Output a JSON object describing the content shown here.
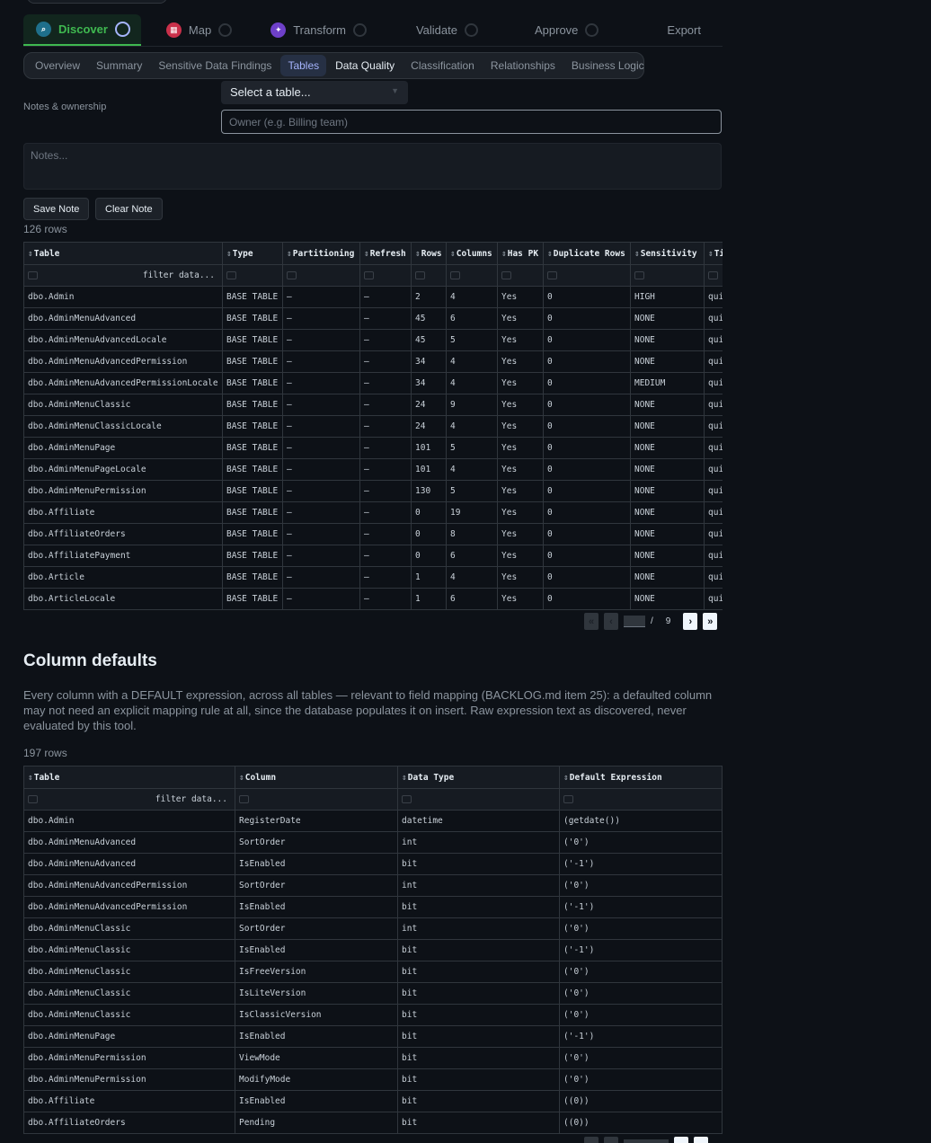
{
  "steps": [
    {
      "label": "Discover",
      "active": true
    },
    {
      "label": "Map"
    },
    {
      "label": "Transform"
    },
    {
      "label": "Validate"
    },
    {
      "label": "Approve"
    },
    {
      "label": "Export"
    }
  ],
  "subtabs": [
    "Overview",
    "Summary",
    "Sensitive Data Findings",
    "Tables",
    "Data Quality",
    "Classification",
    "Relationships",
    "Business Logic"
  ],
  "selected_subtab": "Tables",
  "table_select": {
    "value": "Select a table..."
  },
  "notes": {
    "label": "Notes & ownership",
    "owner_placeholder": "Owner (e.g. Billing team)",
    "notes_placeholder": "Notes...",
    "save_label": "Save Note",
    "clear_label": "Clear Note"
  },
  "tables_grid": {
    "row_count": "126 rows",
    "filter_placeholder": "filter data...",
    "columns": [
      "Table",
      "Type",
      "Partitioning",
      "Refresh",
      "Rows",
      "Columns",
      "Has PK",
      "Duplicate Rows",
      "Sensitivity",
      "Ti"
    ],
    "rows": [
      [
        "dbo.Admin",
        "BASE TABLE",
        "—",
        "—",
        "2",
        "4",
        "Yes",
        "0",
        "HIGH",
        "qui"
      ],
      [
        "dbo.AdminMenuAdvanced",
        "BASE TABLE",
        "—",
        "—",
        "45",
        "6",
        "Yes",
        "0",
        "NONE",
        "qui"
      ],
      [
        "dbo.AdminMenuAdvancedLocale",
        "BASE TABLE",
        "—",
        "—",
        "45",
        "5",
        "Yes",
        "0",
        "NONE",
        "qui"
      ],
      [
        "dbo.AdminMenuAdvancedPermission",
        "BASE TABLE",
        "—",
        "—",
        "34",
        "4",
        "Yes",
        "0",
        "NONE",
        "qui"
      ],
      [
        "dbo.AdminMenuAdvancedPermissionLocale",
        "BASE TABLE",
        "—",
        "—",
        "34",
        "4",
        "Yes",
        "0",
        "MEDIUM",
        "qui"
      ],
      [
        "dbo.AdminMenuClassic",
        "BASE TABLE",
        "—",
        "—",
        "24",
        "9",
        "Yes",
        "0",
        "NONE",
        "qui"
      ],
      [
        "dbo.AdminMenuClassicLocale",
        "BASE TABLE",
        "—",
        "—",
        "24",
        "4",
        "Yes",
        "0",
        "NONE",
        "qui"
      ],
      [
        "dbo.AdminMenuPage",
        "BASE TABLE",
        "—",
        "—",
        "101",
        "5",
        "Yes",
        "0",
        "NONE",
        "qui"
      ],
      [
        "dbo.AdminMenuPageLocale",
        "BASE TABLE",
        "—",
        "—",
        "101",
        "4",
        "Yes",
        "0",
        "NONE",
        "qui"
      ],
      [
        "dbo.AdminMenuPermission",
        "BASE TABLE",
        "—",
        "—",
        "130",
        "5",
        "Yes",
        "0",
        "NONE",
        "qui"
      ],
      [
        "dbo.Affiliate",
        "BASE TABLE",
        "—",
        "—",
        "0",
        "19",
        "Yes",
        "0",
        "NONE",
        "qui"
      ],
      [
        "dbo.AffiliateOrders",
        "BASE TABLE",
        "—",
        "—",
        "0",
        "8",
        "Yes",
        "0",
        "NONE",
        "qui"
      ],
      [
        "dbo.AffiliatePayment",
        "BASE TABLE",
        "—",
        "—",
        "0",
        "6",
        "Yes",
        "0",
        "NONE",
        "qui"
      ],
      [
        "dbo.Article",
        "BASE TABLE",
        "—",
        "—",
        "1",
        "4",
        "Yes",
        "0",
        "NONE",
        "qui"
      ],
      [
        "dbo.ArticleLocale",
        "BASE TABLE",
        "—",
        "—",
        "1",
        "6",
        "Yes",
        "0",
        "NONE",
        "qui"
      ]
    ],
    "pager": {
      "separator": "/",
      "total_pages": "9"
    }
  },
  "column_defaults": {
    "title": "Column defaults",
    "description": "Every column with a DEFAULT expression, across all tables — relevant to field mapping (BACKLOG.md item 25): a defaulted column may not need an explicit mapping rule at all, since the database populates it on insert. Raw expression text as discovered, never evaluated by this tool.",
    "row_count": "197 rows",
    "filter_placeholder": "filter data...",
    "columns": [
      "Table",
      "Column",
      "Data Type",
      "Default Expression"
    ],
    "rows": [
      [
        "dbo.Admin",
        "RegisterDate",
        "datetime",
        "(getdate())"
      ],
      [
        "dbo.AdminMenuAdvanced",
        "SortOrder",
        "int",
        "('0')"
      ],
      [
        "dbo.AdminMenuAdvanced",
        "IsEnabled",
        "bit",
        "('-1')"
      ],
      [
        "dbo.AdminMenuAdvancedPermission",
        "SortOrder",
        "int",
        "('0')"
      ],
      [
        "dbo.AdminMenuAdvancedPermission",
        "IsEnabled",
        "bit",
        "('-1')"
      ],
      [
        "dbo.AdminMenuClassic",
        "SortOrder",
        "int",
        "('0')"
      ],
      [
        "dbo.AdminMenuClassic",
        "IsEnabled",
        "bit",
        "('-1')"
      ],
      [
        "dbo.AdminMenuClassic",
        "IsFreeVersion",
        "bit",
        "('0')"
      ],
      [
        "dbo.AdminMenuClassic",
        "IsLiteVersion",
        "bit",
        "('0')"
      ],
      [
        "dbo.AdminMenuClassic",
        "IsClassicVersion",
        "bit",
        "('0')"
      ],
      [
        "dbo.AdminMenuPage",
        "IsEnabled",
        "bit",
        "('-1')"
      ],
      [
        "dbo.AdminMenuPermission",
        "ViewMode",
        "bit",
        "('0')"
      ],
      [
        "dbo.AdminMenuPermission",
        "ModifyMode",
        "bit",
        "('0')"
      ],
      [
        "dbo.Affiliate",
        "IsEnabled",
        "bit",
        "((0))"
      ],
      [
        "dbo.AffiliateOrders",
        "Pending",
        "bit",
        "((0))"
      ]
    ]
  },
  "colors": {
    "accent": "#3fb950",
    "tab_selected": "#a5b4fc"
  }
}
